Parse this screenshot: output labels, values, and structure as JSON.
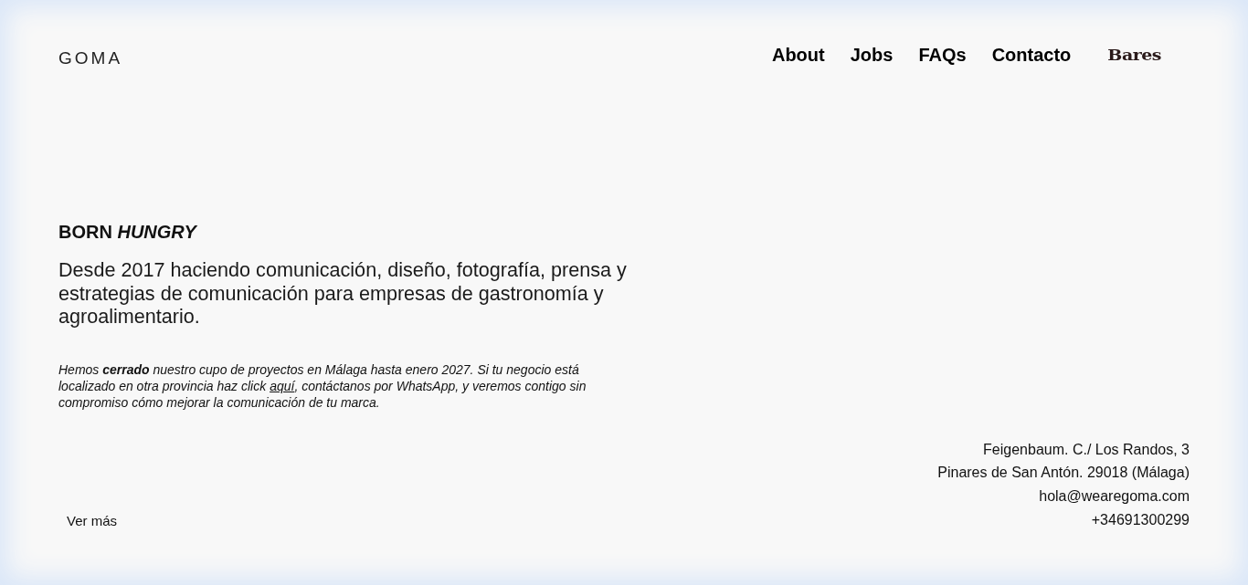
{
  "header": {
    "logo": "GOMA",
    "nav": [
      {
        "label": "About",
        "kind": "link"
      },
      {
        "label": "Jobs",
        "kind": "link"
      },
      {
        "label": "FAQs",
        "kind": "link"
      },
      {
        "label": "Contacto",
        "kind": "link"
      },
      {
        "label": "Bares",
        "kind": "brand"
      }
    ]
  },
  "hero": {
    "headline": "BORN *HUNGRY*",
    "intro": "Desde 2017 haciendo comunicación, diseño, fotografía, prensa y estrategias de comunicación para empresas de gastronomía y agroalimentario.",
    "notice": {
      "before": "Hemos **cerrado** nuestro cupo de proyectos en Málaga hasta enero 2027. Si tu negocio está localizado en otra provincia haz click ",
      "link": "aquí",
      "after": ", contáctanos por WhatsApp, y veremos contigo sin compromiso cómo mejorar la comunicación de tu marca."
    }
  },
  "footer": {
    "more_link": "Ver más",
    "address": [
      "Feigenbaum. C./ Los Randos, 3",
      "Pinares de San Antón. 29018 (Málaga)"
    ],
    "email": "hola@wearegoma.com",
    "phone": "+34691300299"
  }
}
